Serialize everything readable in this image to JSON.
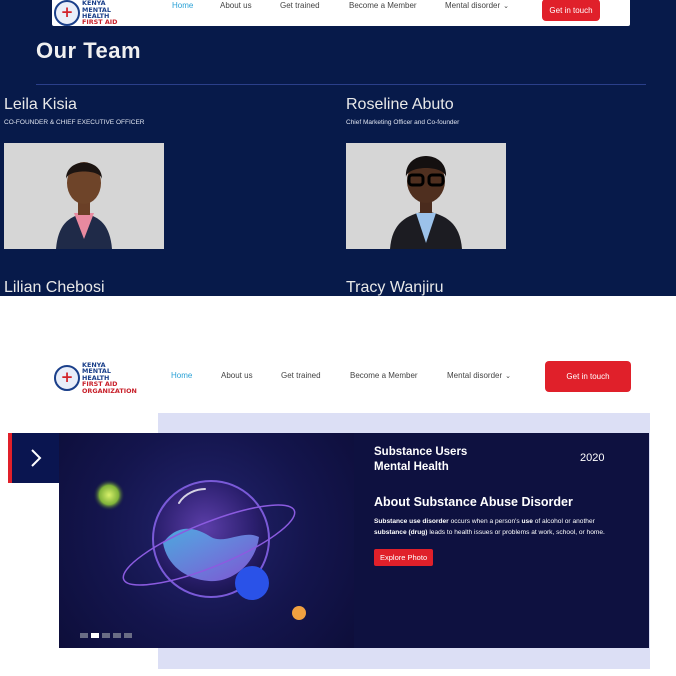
{
  "brand": {
    "logo_lines": [
      "KENYA",
      "MENTAL",
      "HEALTH",
      "FIRST AID",
      "ORGANIZATION"
    ]
  },
  "nav": {
    "items": [
      {
        "label": "Home",
        "active": true
      },
      {
        "label": "About us",
        "active": false
      },
      {
        "label": "Get trained",
        "active": false
      },
      {
        "label": "Become a Member",
        "active": false
      },
      {
        "label": "Mental disorder",
        "active": false
      }
    ],
    "cta_label": "Get in touch"
  },
  "team": {
    "title": "Our Team",
    "members": [
      {
        "name": "Leila Kisia",
        "role": "CO-FOUNDER & CHIEF EXECUTIVE OFFICER"
      },
      {
        "name": "Roseline Abuto",
        "role": "Chief Marketing Officer and Co-founder"
      },
      {
        "name": "Lilian Chebosi",
        "role": ""
      },
      {
        "name": "Tracy Wanjiru",
        "role": ""
      }
    ]
  },
  "slider": {
    "subtitle_line1": "Substance Users",
    "subtitle_line2": "Mental Health",
    "year": "2020",
    "heading": "About Substance Abuse Disorder",
    "body_part1": "Substance use disorder",
    "body_part2": " occurs when a person's ",
    "body_part3": "use",
    "body_part4": " of alcohol or another",
    "body_part5": "substance (drug)",
    "body_part6": " leads to health issues or problems at work, school, or home.",
    "button_label": "Explore Photo",
    "dots_count": 5,
    "active_dot": 2
  },
  "colors": {
    "navy": "#071a4a",
    "accent_red": "#e0202a",
    "link_blue": "#2aa1d6"
  }
}
